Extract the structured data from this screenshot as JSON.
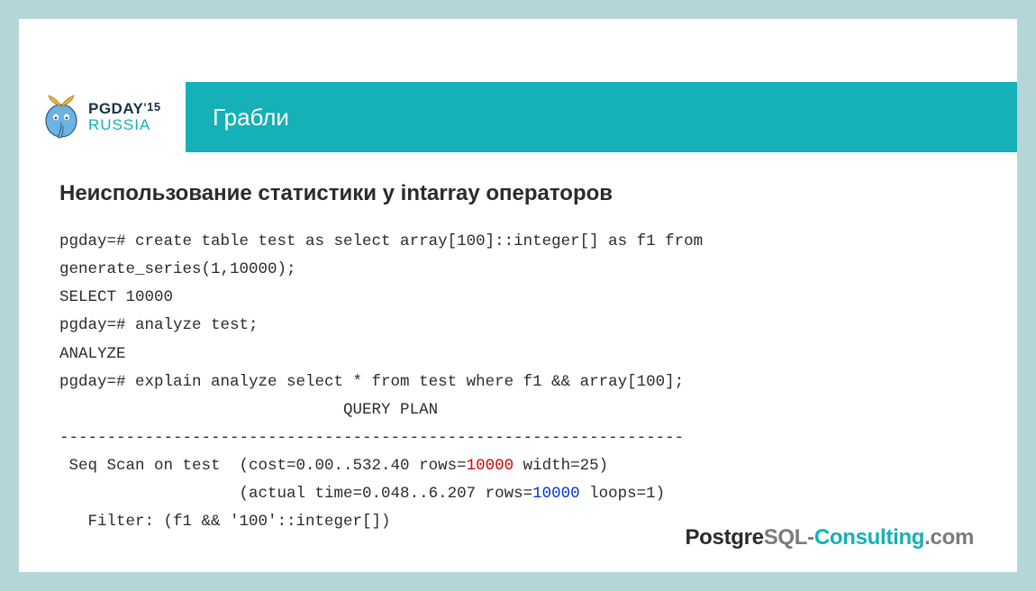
{
  "logo": {
    "line1_main": "PGDAY",
    "line1_apostrophe": "'",
    "line1_year": "15",
    "line2": "RUSSIA"
  },
  "title": "Грабли",
  "section_heading": "Неиспользование статистики у intarray операторов",
  "code": {
    "l1": "pgday=# create table test as select array[100]::integer[] as f1 from",
    "l2": "generate_series(1,10000);",
    "l3": "SELECT 10000",
    "l4": "pgday=# analyze test;",
    "l5": "ANALYZE",
    "l6": "pgday=# explain analyze select * from test where f1 && array[100];",
    "l7": "                              QUERY PLAN",
    "l8": "------------------------------------------------------------------",
    "l9a": " Seq Scan on test  (cost=0.00..532.40 rows=",
    "l9b": "10000",
    "l9c": " width=25)",
    "l10a": "                   (actual time=0.048..6.207 rows=",
    "l10b": "10000",
    "l10c": " loops=1)",
    "l11": "   Filter: (f1 && '100'::integer[])"
  },
  "footer": {
    "p1": "Postgre",
    "p2": "SQL-",
    "p3": "Consulting",
    "p4": ".com"
  }
}
